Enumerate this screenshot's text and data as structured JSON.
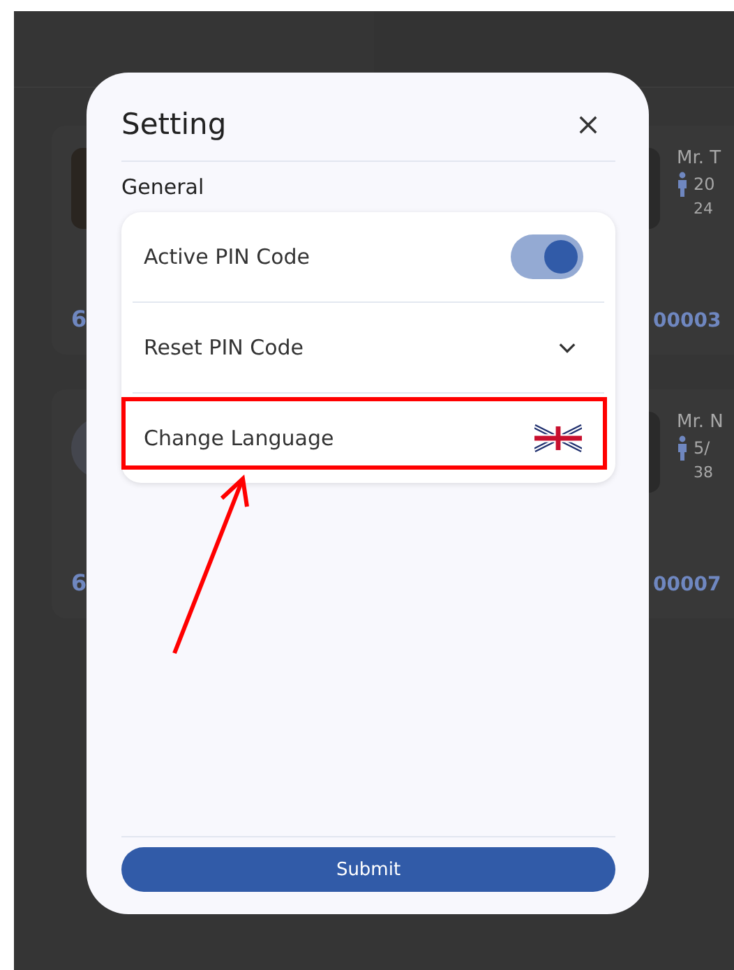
{
  "background": {
    "rows": [
      {
        "left": {
          "kind": "photo",
          "id_fragment": "6"
        },
        "right": {
          "name": "Mr. T",
          "line_1": "20",
          "line_2": "24",
          "id_fragment": "00003"
        }
      },
      {
        "left": {
          "kind": "circle",
          "id_fragment": "6"
        },
        "right": {
          "name": "Mr. N",
          "line_1": "5/",
          "line_2": "38",
          "id_fragment": "00007"
        }
      }
    ]
  },
  "modal": {
    "title": "Setting",
    "section": "General",
    "rows": [
      {
        "kind": "toggle",
        "label": "Active PIN Code",
        "on": true
      },
      {
        "kind": "dropdown",
        "label": "Reset PIN Code",
        "expanded": false
      },
      {
        "kind": "language",
        "label": "Change Language"
      }
    ],
    "submit": "Submit"
  }
}
